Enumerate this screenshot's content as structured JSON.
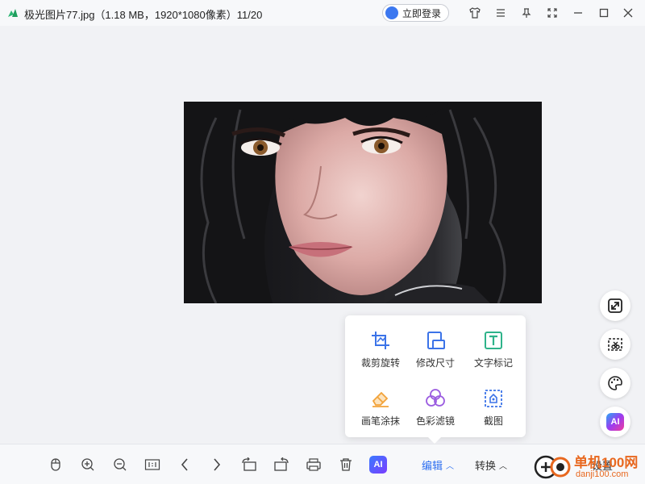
{
  "window": {
    "title": "极光图片77.jpg（1.18 MB，1920*1080像素）11/20",
    "login_label": "立即登录",
    "icons": [
      "skin-icon",
      "menu-icon",
      "pin-icon",
      "fullscreen-icon",
      "minimize-icon",
      "maximize-icon",
      "close-icon"
    ]
  },
  "side_tools": [
    {
      "name": "fit-screen-icon"
    },
    {
      "name": "cutout-icon"
    },
    {
      "name": "palette-icon"
    },
    {
      "name": "ai-icon",
      "label": "AI"
    }
  ],
  "edit_menu": {
    "items": [
      {
        "label": "裁剪旋转",
        "icon": "crop-rotate-icon"
      },
      {
        "label": "修改尺寸",
        "icon": "resize-icon"
      },
      {
        "label": "文字标记",
        "icon": "text-mark-icon"
      },
      {
        "label": "画笔涂抹",
        "icon": "eraser-brush-icon"
      },
      {
        "label": "色彩滤镜",
        "icon": "color-filter-icon"
      },
      {
        "label": "截图",
        "icon": "screenshot-icon"
      }
    ]
  },
  "toolbar": {
    "ai_label": "AI",
    "edit_label": "编辑",
    "convert_label": "转换",
    "tools_label": "工具",
    "settings_label": "设置"
  },
  "watermark": {
    "line1": "单机100网",
    "line2": "danji100.com"
  },
  "colors": {
    "accent": "#2e6ff0",
    "crop_icon": "#3b73e8",
    "resize_icon": "#3b73e8",
    "text_icon": "#2fb38a",
    "eraser_icon": "#f2a33a",
    "filter_icon": "#9b5ce0",
    "screenshot_icon": "#3b73e8",
    "watermark": "#e8681f"
  }
}
